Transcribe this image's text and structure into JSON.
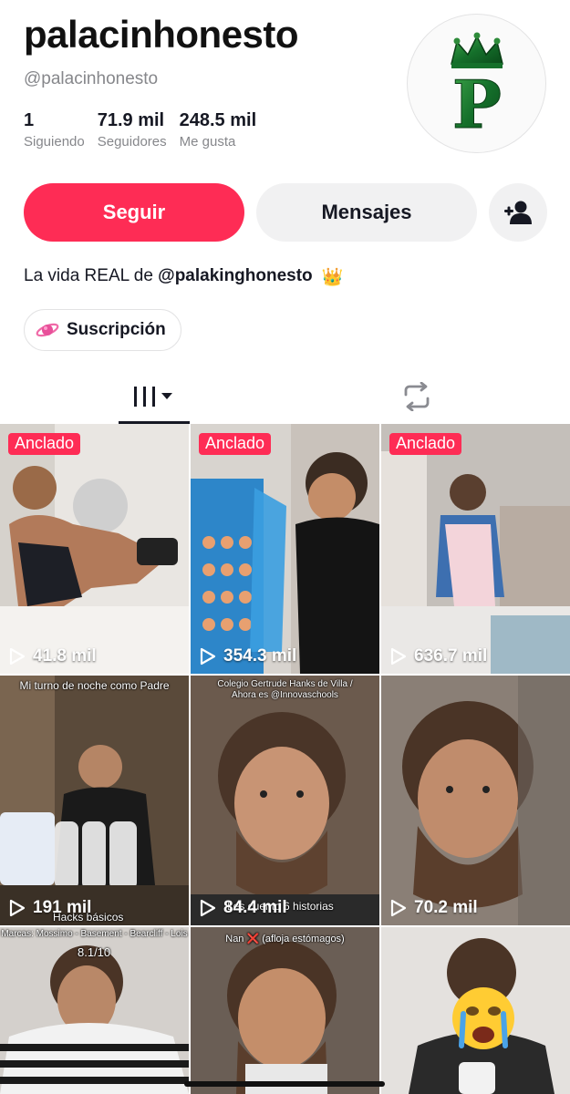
{
  "profile": {
    "name": "palacinhonesto",
    "handle": "@palacinhonesto",
    "stats": [
      {
        "value": "1",
        "label": "Siguiendo"
      },
      {
        "value": "71.9 mil",
        "label": "Seguidores"
      },
      {
        "value": "248.5 mil",
        "label": "Me gusta"
      }
    ],
    "avatar_letter": "P"
  },
  "actions": {
    "follow": "Seguir",
    "message": "Mensajes",
    "add_friend_icon": "add-person-icon"
  },
  "bio": {
    "prefix": "La vida REAL de ",
    "mention": "@palakinghonesto",
    "emoji": "👑"
  },
  "subscription": {
    "label": "Suscripción"
  },
  "tabs": {
    "videos_icon": "grid-icon",
    "reposts_icon": "repost-icon"
  },
  "colors": {
    "accent": "#fe2c55",
    "secondary_button": "#f1f1f2"
  },
  "videos": [
    {
      "pinned": "Anclado",
      "views": "41.8 mil",
      "overlay": ""
    },
    {
      "pinned": "Anclado",
      "views": "354.3 mil",
      "overlay": ""
    },
    {
      "pinned": "Anclado",
      "views": "636.7 mil",
      "overlay": ""
    },
    {
      "pinned": "",
      "views": "191 mil",
      "overlay": "Mi turno de noche como Padre",
      "overlay2": "Hacks básicos"
    },
    {
      "pinned": "",
      "views": "84.4 mil",
      "overlay": "Colegio Gertrude Hanks de Villa / Ahora es @Innovaschools",
      "overlay2": "Les cuento 6 historias"
    },
    {
      "pinned": "",
      "views": "70.2 mil",
      "overlay": ""
    },
    {
      "pinned": "",
      "views": "",
      "overlay": "Marcas: Mossimo - Basement - Bearcliff - Lois",
      "overlay2": "8.1/10"
    },
    {
      "pinned": "",
      "views": "",
      "overlay": "Nan ❌ (afloja estómagos)"
    },
    {
      "pinned": "",
      "views": "",
      "overlay": ""
    }
  ]
}
